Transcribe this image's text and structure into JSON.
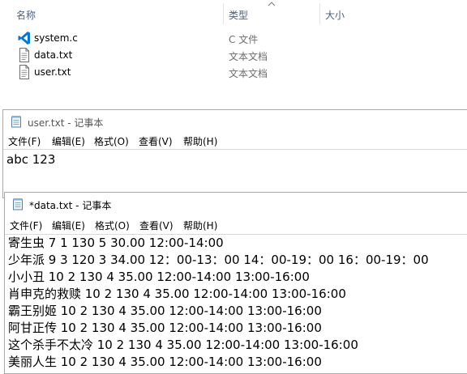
{
  "explorer": {
    "columns": {
      "name": "名称",
      "type": "类型",
      "size": "大小"
    },
    "files": [
      {
        "name": "system.c",
        "type": "C 文件",
        "icon": "vscode-icon"
      },
      {
        "name": "data.txt",
        "type": "文本文档",
        "icon": "text-file-icon"
      },
      {
        "name": "user.txt",
        "type": "文本文档",
        "icon": "text-file-icon"
      }
    ]
  },
  "notepad_user": {
    "title": "user.txt - 记事本",
    "menu": [
      "文件(F)",
      "编辑(E)",
      "格式(O)",
      "查看(V)",
      "帮助(H)"
    ],
    "lines": [
      "abc 123"
    ]
  },
  "notepad_data": {
    "title": "*data.txt - 记事本",
    "menu": [
      "文件(F)",
      "编辑(E)",
      "格式(O)",
      "查看(V)",
      "帮助(H)"
    ],
    "lines": [
      "寄生虫 7 1 130 5 30.00 12:00-14:00",
      "少年派 9 3 120 3 34.00 12：00-13：00 14：00-19：00 16：00-19：00",
      "小小丑 10 2 130 4 35.00 12:00-14:00 13:00-16:00",
      "肖申克的救赎 10 2 130 4 35.00 12:00-14:00 13:00-16:00",
      "霸王别姬 10 2 130 4 35.00 12:00-14:00 13:00-16:00",
      "阿甘正传 10 2 130 4 35.00 12:00-14:00 13:00-16:00",
      "这个杀手不太冷 10 2 130 4 35.00 12:00-14:00 13:00-16:00",
      "美丽人生 10 2 130 4 35.00 12:00-14:00 13:00-16:00"
    ]
  },
  "colors": {
    "header_text": "#4c607a",
    "vscode_blue": "#0078d7",
    "border": "#aaaaaa"
  }
}
